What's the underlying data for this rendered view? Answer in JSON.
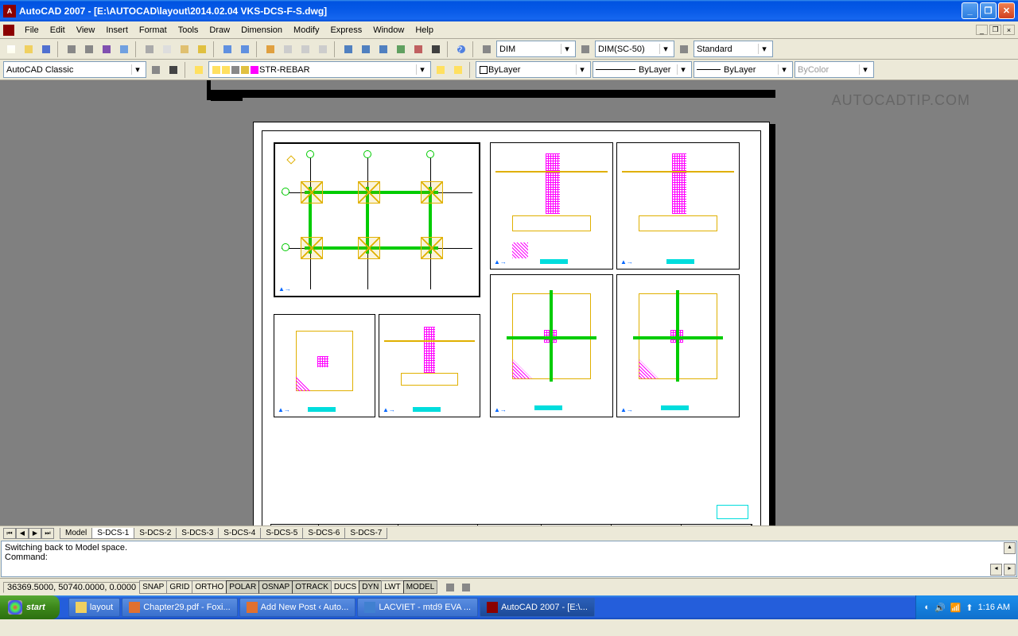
{
  "title": "AutoCAD 2007 - [E:\\AUTOCAD\\layout\\2014.02.04 VKS-DCS-F-S.dwg]",
  "menu": [
    "File",
    "Edit",
    "View",
    "Insert",
    "Format",
    "Tools",
    "Draw",
    "Dimension",
    "Modify",
    "Express",
    "Window",
    "Help"
  ],
  "workspace_dd": "AutoCAD Classic",
  "layer_name": "STR-REBAR",
  "dimstyle": "DIM",
  "dimstyle2": "DIM(SC-50)",
  "textstyle": "Standard",
  "linetype": "ByLayer",
  "lineweight": "ByLayer",
  "color": "ByLayer",
  "plotstyle": "ByColor",
  "watermark": "AUTOCADTIP.COM",
  "tabs": [
    "Model",
    "S-DCS-1",
    "S-DCS-2",
    "S-DCS-3",
    "S-DCS-4",
    "S-DCS-5",
    "S-DCS-6",
    "S-DCS-7"
  ],
  "active_tab": 1,
  "cmd_line1": "Switching back to Model space.",
  "cmd_line2": "Command:",
  "coords": "36369.5000, 50740.0000, 0.0000",
  "status_buttons": [
    "SNAP",
    "GRID",
    "ORTHO",
    "POLAR",
    "OSNAP",
    "OTRACK",
    "DUCS",
    "DYN",
    "LWT",
    "MODEL"
  ],
  "status_on": [
    3,
    4,
    5,
    7,
    9
  ],
  "taskbar_start": "start",
  "taskbar_tasks": [
    {
      "label": "layout",
      "icon": "#f0d060"
    },
    {
      "label": "Chapter29.pdf - Foxi...",
      "icon": "#e07030"
    },
    {
      "label": "Add New Post ‹ Auto...",
      "icon": "#e07030"
    },
    {
      "label": "LACVIET - mtd9 EVA ...",
      "icon": "#4080d0"
    },
    {
      "label": "AutoCAD 2007 - [E:\\...",
      "icon": "#8b0000",
      "active": true
    }
  ],
  "clock": "1:16 AM"
}
